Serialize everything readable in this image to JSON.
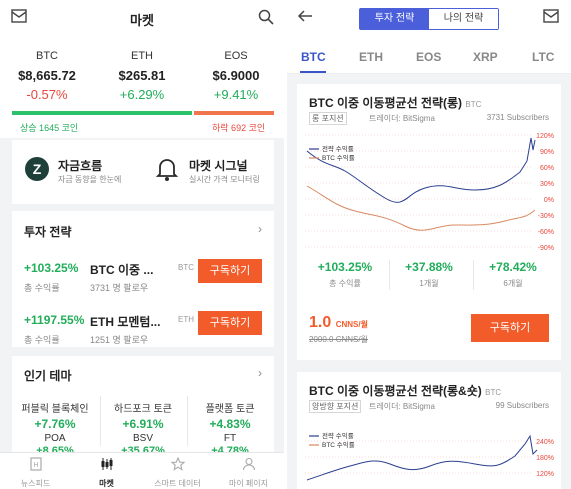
{
  "left": {
    "header": {
      "title": "마켓"
    },
    "tickers": [
      {
        "symbol": "BTC",
        "price": "$8,665.72",
        "change": "-0.57%",
        "direction": "down"
      },
      {
        "symbol": "ETH",
        "price": "$265.81",
        "change": "+6.29%",
        "direction": "up"
      },
      {
        "symbol": "EOS",
        "price": "$6.9000",
        "change": "+9.41%",
        "direction": "up"
      }
    ],
    "market_ratio": {
      "up_label": "상승 1645 코인",
      "down_label": "하락 692 코인",
      "up_fraction": 0.7
    },
    "features": [
      {
        "title": "자금흐름",
        "subtitle": "자금 동향을 한눈에",
        "icon": "fund-flow-icon"
      },
      {
        "title": "마켓 시그널",
        "subtitle": "실시간 가격 모니터링",
        "icon": "bell-icon"
      }
    ],
    "strategies": {
      "title": "투자 전략",
      "items": [
        {
          "return": "+103.25%",
          "return_label": "총 수익률",
          "name": "BTC 이중 ...",
          "subscribers": "3731 명 팔로우",
          "tag": "BTC",
          "button": "구독하기"
        },
        {
          "return": "+1197.55%",
          "return_label": "총 수익률",
          "name": "ETH 모멘텀...",
          "subscribers": "1251 명 팔로우",
          "tag": "ETH",
          "button": "구독하기"
        }
      ]
    },
    "themes": {
      "title": "인기 테마",
      "items": [
        {
          "name": "퍼블릭 블록체인",
          "change": "+7.76%",
          "coin": "POA",
          "coin_change": "+8.65%"
        },
        {
          "name": "하드포크 토큰",
          "change": "+6.91%",
          "coin": "BSV",
          "coin_change": "+35.67%"
        },
        {
          "name": "플랫폼 토큰",
          "change": "+4.83%",
          "coin": "FT",
          "coin_change": "+4.78%"
        }
      ]
    },
    "bottom_nav": [
      {
        "label": "뉴스피드",
        "icon": "news-icon",
        "active": false
      },
      {
        "label": "마켓",
        "icon": "candlestick-icon",
        "active": true
      },
      {
        "label": "스마트 데이터",
        "icon": "star-icon",
        "active": false
      },
      {
        "label": "마이 페이지",
        "icon": "user-icon",
        "active": false
      }
    ]
  },
  "right": {
    "segment": {
      "active": "투자 전략",
      "inactive": "나의 전략"
    },
    "coin_tabs": [
      "BTC",
      "ETH",
      "EOS",
      "XRP",
      "LTC"
    ],
    "active_coin_tab": "BTC",
    "cards": [
      {
        "title": "BTC 이중 이동평균선 전략(롱)",
        "title_tag": "BTC",
        "position": "롱 포지션",
        "trader": "트레이더: BitSigma",
        "subscribers": "3731 Subscribers",
        "legend_strategy": "전략 수익률",
        "legend_btc": "BTC 수익률",
        "y_ticks": [
          "120%",
          "90%",
          "60%",
          "30%",
          "0%",
          "-30%",
          "-60%",
          "-90%"
        ],
        "stats": [
          {
            "value": "+103.25%",
            "label": "총 수익률"
          },
          {
            "value": "+37.88%",
            "label": "1개월"
          },
          {
            "value": "+78.42%",
            "label": "6개월"
          }
        ],
        "price": "1.0",
        "price_unit": "CNNS/월",
        "old_price": "2000.0 CNNS/월",
        "button": "구독하기"
      },
      {
        "title": "BTC 이중 이동평균선 전략(롱&숏)",
        "title_tag": "BTC",
        "position": "양방향 포지션",
        "trader": "트레이더: BitSigma",
        "subscribers": "99 Subscribers",
        "legend_strategy": "전략 수익률",
        "legend_btc": "BTC 수익률",
        "y_ticks": [
          "240%",
          "180%",
          "120%"
        ]
      }
    ]
  },
  "colors": {
    "accent": "#4a5fd9",
    "up": "#21ad5a",
    "down": "#e9473d",
    "button": "#f25c2a",
    "strategy_line": "#2b3e8f",
    "btc_line": "#d98a62"
  }
}
